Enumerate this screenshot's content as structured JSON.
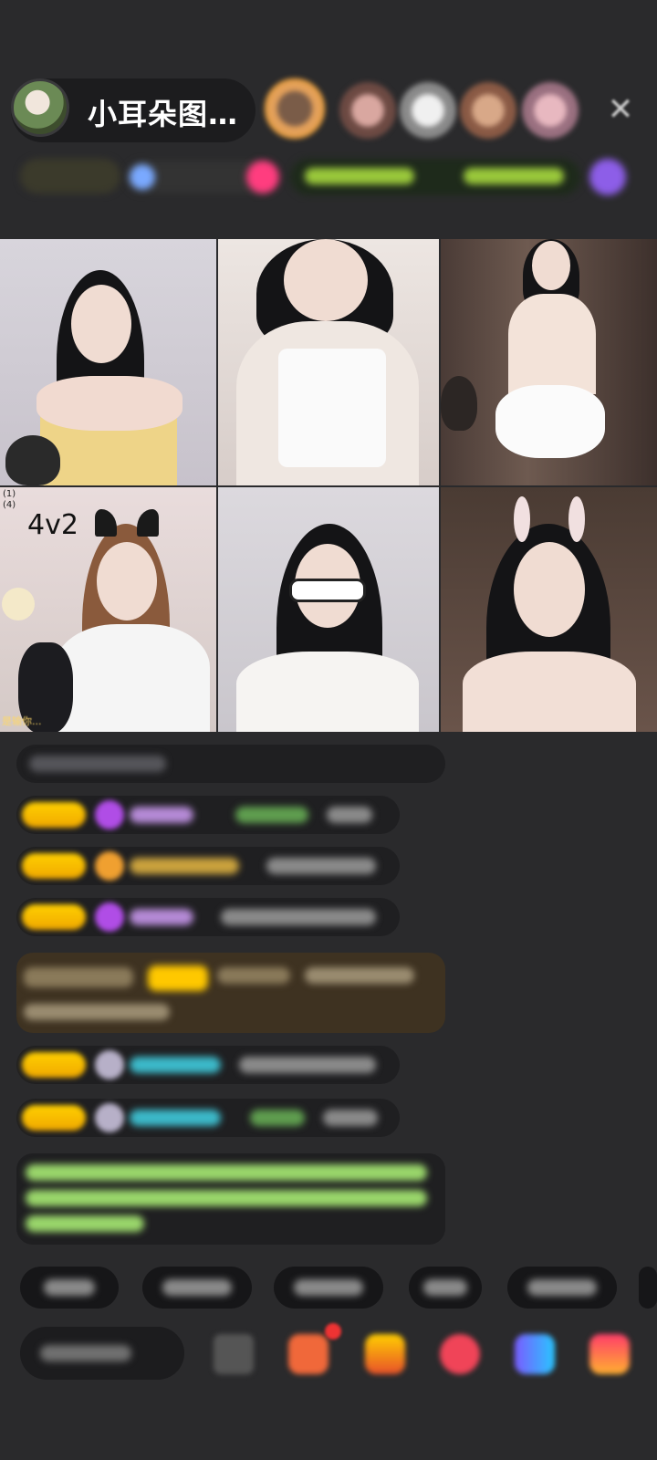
{
  "header": {
    "host_name": "小耳朵图…",
    "close_icon": "close-icon"
  },
  "grid": {
    "mode_label": "4v2",
    "tile_small_1": "(1)",
    "tile_small_2": "(4)",
    "tile_caption": "是输你..."
  },
  "colors": {
    "background": "#2a2a2c",
    "chat_bubble": "#1f1f21",
    "gift_bubble": "#3e3221",
    "badge_yellow": "#ffc800",
    "gem_purple": "#b04de6",
    "name_purple": "#b58ad6",
    "name_teal": "#3cb9c9",
    "text_green": "#9ad66b"
  }
}
